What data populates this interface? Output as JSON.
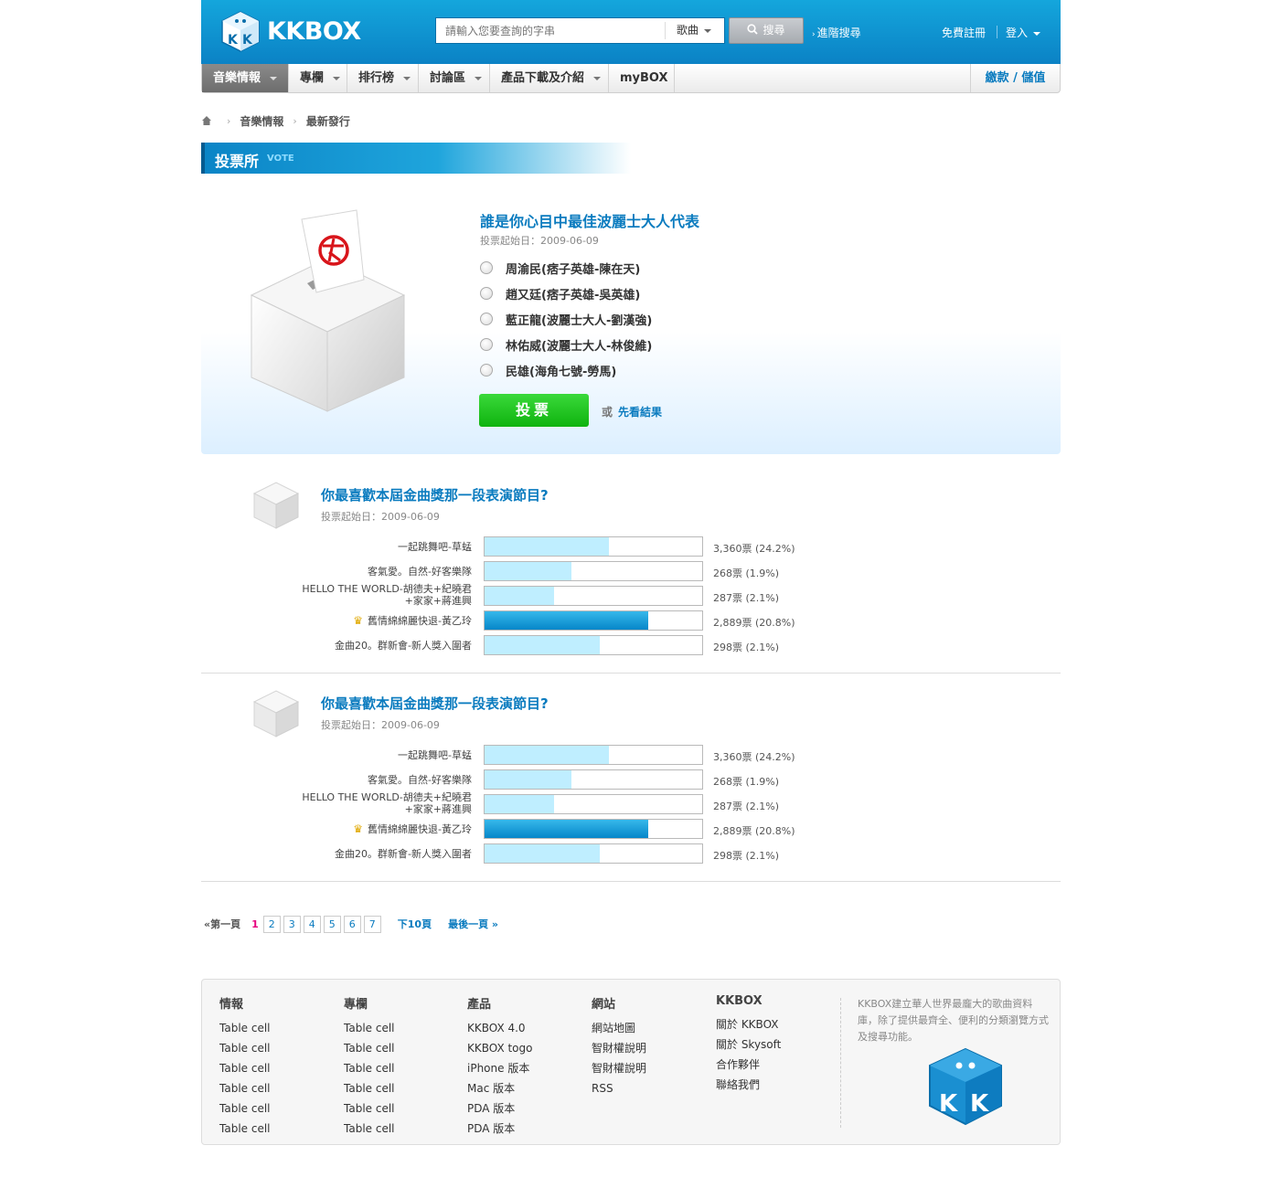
{
  "header": {
    "logo_text": "KKBOX",
    "search_placeholder": "請輸入您要查詢的字串",
    "search_type": "歌曲",
    "search_button": "搜尋",
    "advanced_search": "進階搜尋",
    "signup": "免費註冊",
    "login": "登入"
  },
  "nav": {
    "items": [
      "音樂情報",
      "專欄",
      "排行榜",
      "討論區",
      "產品下載及介紹",
      "myBOX"
    ],
    "pay": "繳款 / 儲值"
  },
  "breadcrumb": [
    "音樂情報",
    "最新發行"
  ],
  "section": {
    "title": "投票所",
    "subtitle": "VOTE"
  },
  "vote": {
    "question": "誰是你心目中最佳波麗士大人代表",
    "date": "投票起始日：2009-06-09",
    "options": [
      "周渝民(痞子英雄-陳在天)",
      "趙又廷(痞子英雄-吳英雄)",
      "藍正龍(波麗士大人-劉漢強)",
      "林佑威(波麗士大人-林俊維)",
      "民雄(海角七號-勞馬)"
    ],
    "vote_button": "投票",
    "or": "或",
    "see_results": "先看結果"
  },
  "polls": [
    {
      "title": "你最喜歡本屆金曲獎那一段表演節目?",
      "date": "投票起始日：2009-06-09",
      "rows": [
        {
          "label": "一起跳舞吧-草蜢",
          "label2": "",
          "value": "3,360票 (24.2%)",
          "fill": 0.57,
          "top": false
        },
        {
          "label": "客氣愛。自然-好客樂隊",
          "label2": "",
          "value": "268票 (1.9%)",
          "fill": 0.4,
          "top": false
        },
        {
          "label": "HELLO THE WORLD-胡德夫+紀曉君",
          "label2": "+家家+蔣進興",
          "value": "287票 (2.1%)",
          "fill": 0.32,
          "top": false
        },
        {
          "label": "舊情綿綿麗快退-黃乙玲",
          "label2": "",
          "value": "2,889票 (20.8%)",
          "fill": 0.75,
          "top": true
        },
        {
          "label": "金曲20。群新會-新人獎入圍者",
          "label2": "",
          "value": "298票 (2.1%)",
          "fill": 0.53,
          "top": false
        }
      ]
    },
    {
      "title": "你最喜歡本屆金曲獎那一段表演節目?",
      "date": "投票起始日：2009-06-09",
      "rows": [
        {
          "label": "一起跳舞吧-草蜢",
          "label2": "",
          "value": "3,360票 (24.2%)",
          "fill": 0.57,
          "top": false
        },
        {
          "label": "客氣愛。自然-好客樂隊",
          "label2": "",
          "value": "268票 (1.9%)",
          "fill": 0.4,
          "top": false
        },
        {
          "label": "HELLO THE WORLD-胡德夫+紀曉君",
          "label2": "+家家+蔣進興",
          "value": "287票 (2.1%)",
          "fill": 0.32,
          "top": false
        },
        {
          "label": "舊情綿綿麗快退-黃乙玲",
          "label2": "",
          "value": "2,889票 (20.8%)",
          "fill": 0.75,
          "top": true
        },
        {
          "label": "金曲20。群新會-新人獎入圍者",
          "label2": "",
          "value": "298票 (2.1%)",
          "fill": 0.53,
          "top": false
        }
      ]
    }
  ],
  "pager": {
    "first": "«第一頁",
    "current": "1",
    "pages": [
      "2",
      "3",
      "4",
      "5",
      "6",
      "7"
    ],
    "next10": "下10頁",
    "last": "最後一頁 »"
  },
  "footer": {
    "columns": [
      {
        "title": "情報",
        "items": [
          "Table cell",
          "Table cell",
          "Table cell",
          "Table cell",
          "Table cell",
          "Table cell"
        ]
      },
      {
        "title": "專欄",
        "items": [
          "Table cell",
          "Table cell",
          "Table cell",
          "Table cell",
          "Table cell",
          "Table cell"
        ]
      },
      {
        "title": "產品",
        "items": [
          "KKBOX 4.0",
          "KKBOX togo",
          "iPhone 版本",
          "Mac 版本",
          "PDA 版本",
          "PDA 版本"
        ]
      },
      {
        "title": "網站",
        "items": [
          "網站地圖",
          "智財權說明",
          "智財權說明",
          "RSS"
        ]
      },
      {
        "title": "KKBOX",
        "items": [
          "關於 KKBOX",
          "關於 Skysoft",
          "合作夥伴",
          "聯絡我們"
        ]
      }
    ],
    "description": "KKBOX建立華人世界最龐大的歌曲資料庫，除了提供最齊全、便利的分類瀏覽方式及搜尋功能。"
  }
}
